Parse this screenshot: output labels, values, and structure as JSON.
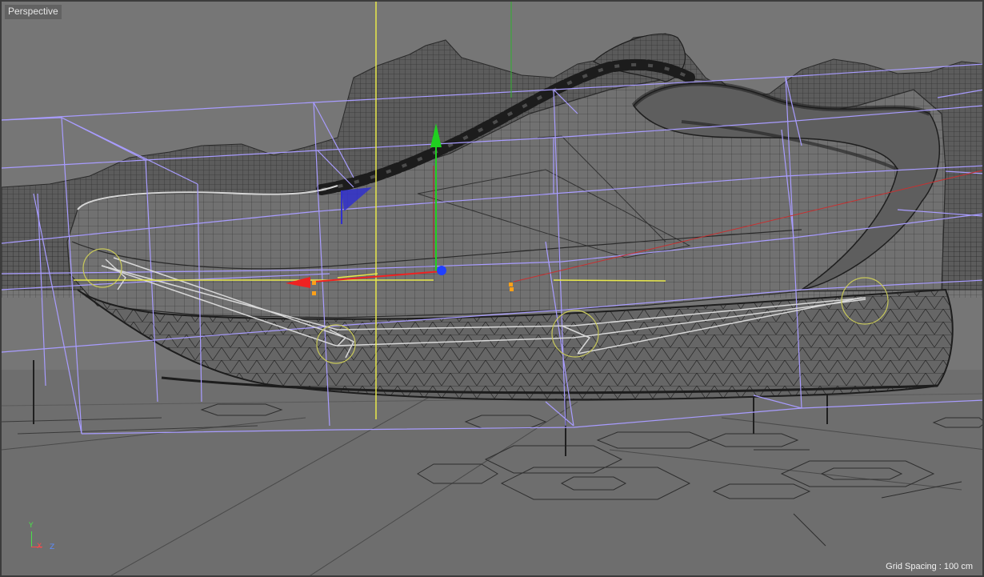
{
  "viewport": {
    "label": "Perspective",
    "grid_spacing": "Grid Spacing : 100 cm"
  },
  "axis_indicator": {
    "y": "Y",
    "x": "X",
    "z": "Z"
  },
  "colors": {
    "background": "#767676",
    "wire": "#2b2b2b",
    "cage": "#a89cff",
    "x_axis": "#ff2a2a",
    "y_axis": "#20d020",
    "z_axis": "#2040ff",
    "spline": "#dcdcdc",
    "guide": "#e8e84a",
    "handle": "#ffa019"
  },
  "icons": [
    "move-manipulator-icon",
    "axis-orientation-icon"
  ]
}
